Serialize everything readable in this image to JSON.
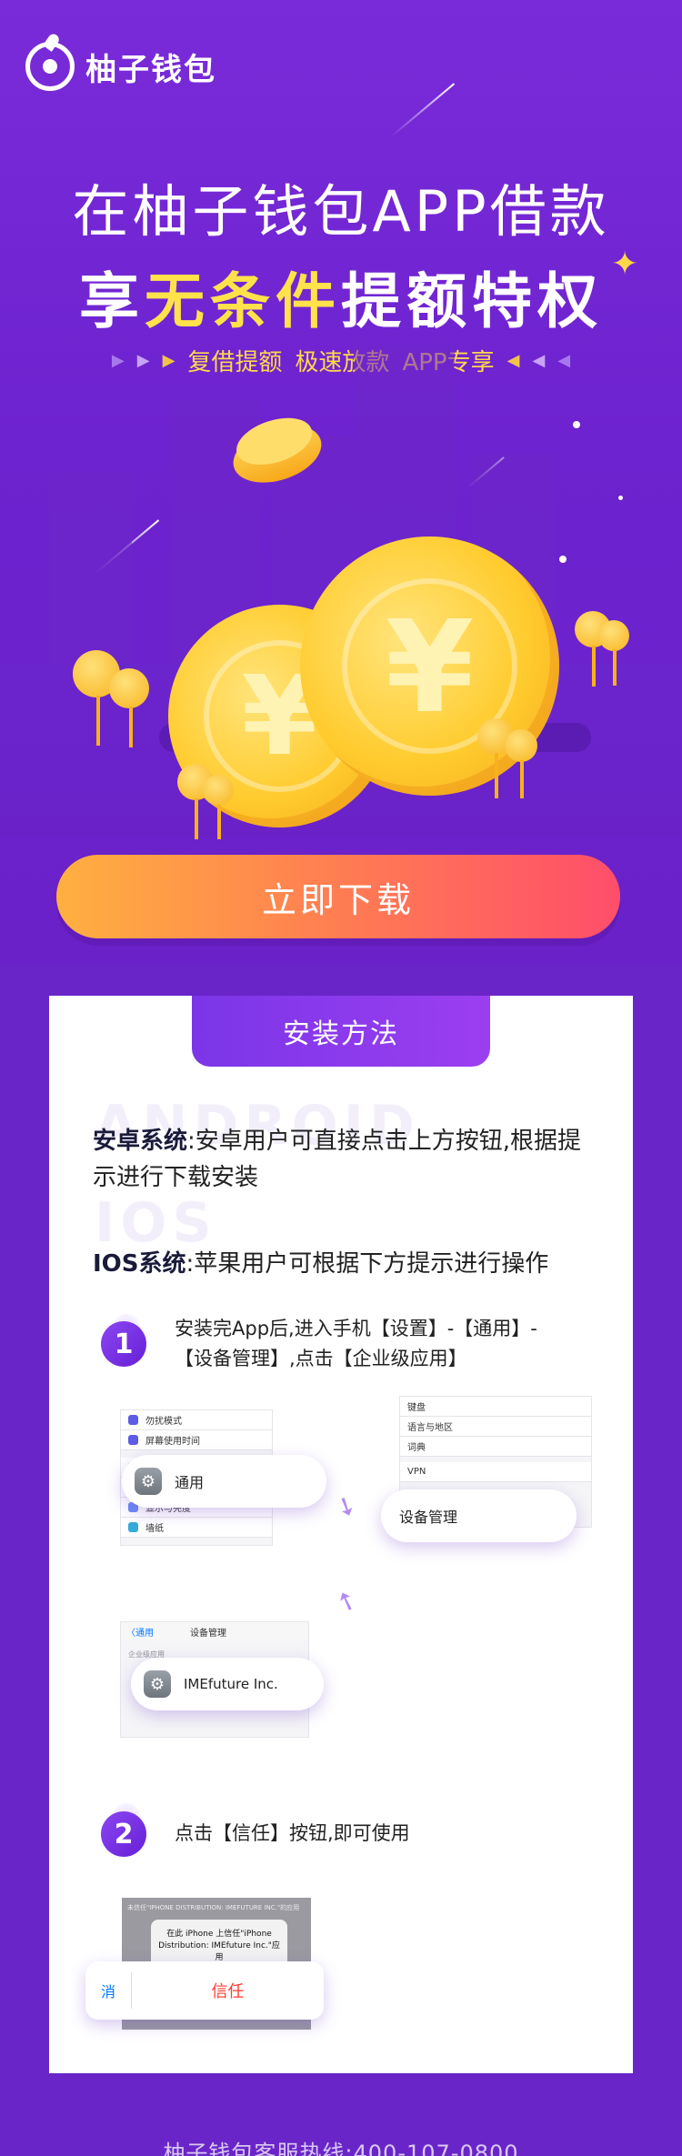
{
  "brand": {
    "name": "柚子钱包"
  },
  "hero": {
    "headline_line1": "在柚子钱包APP借款",
    "headline_line2_pre": "享",
    "headline_line2_highlight": "无条件",
    "headline_line2_post": "提额特权",
    "tags": [
      "复借提额",
      "极速放款",
      "APP专享"
    ],
    "coin_symbol": "¥"
  },
  "cta": {
    "download_label": "立即下载"
  },
  "install": {
    "tab_label": "安装方法",
    "ghost_android": "ANDROID",
    "ghost_ios": "IOS",
    "android_title": "安卓系统",
    "android_text": ":安卓用户可直接点击上方按钮,根据提示进行下载安装",
    "ios_title": "IOS系统",
    "ios_text": ":苹果用户可根据下方提示进行操作",
    "step1": {
      "number": "1",
      "text": "安装完App后,进入手机【设置】-【通用】-【设备管理】,点击【企业级应用】"
    },
    "step2": {
      "number": "2",
      "text": "点击【信任】按钮,即可使用"
    },
    "shot1": {
      "rows": [
        "勿扰模式",
        "屏幕使用时间",
        "",
        "显示与亮度",
        "墙纸"
      ],
      "pill_label": "通用"
    },
    "shot2": {
      "rows": [
        "键盘",
        "语言与地区",
        "词典",
        "VPN"
      ],
      "pill_label": "设备管理"
    },
    "shot3": {
      "back": "〈通用",
      "title": "设备管理",
      "section": "企业级应用",
      "pill_label": "IMEfuture Inc."
    },
    "shot4": {
      "header": "未信任\"IPHONE DISTRIBUTION: IMEFUTURE INC.\"的应用",
      "dialog_title": "在此 iPhone 上信任\"iPhone Distribution: IMEfuture Inc.\"应用",
      "cancel_fragment": "消",
      "trust_label": "信任"
    }
  },
  "footer": {
    "hotline": "柚子钱包客服热线:400-107-0800"
  }
}
